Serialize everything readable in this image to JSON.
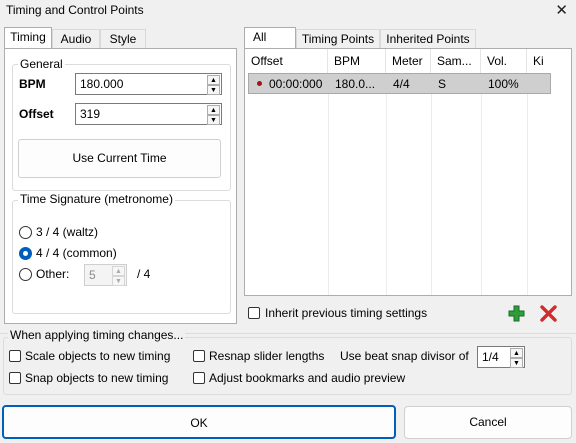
{
  "window": {
    "title": "Timing and Control Points"
  },
  "left_tabs": [
    "Timing",
    "Audio",
    "Style"
  ],
  "general": {
    "legend": "General",
    "bpm_label": "BPM",
    "bpm_value": "180.000",
    "offset_label": "Offset",
    "offset_value": "319",
    "use_current_time": "Use Current Time"
  },
  "time_signature": {
    "legend": "Time Signature (metronome)",
    "options": [
      "3 / 4 (waltz)",
      "4 / 4 (common)",
      "Other:"
    ],
    "selected_index": 1,
    "other_value": "5",
    "other_suffix": "/ 4"
  },
  "right_tabs": [
    "All",
    "Timing Points",
    "Inherited Points"
  ],
  "table": {
    "columns": [
      "Offset",
      "BPM",
      "Meter",
      "Sam...",
      "Vol.",
      "Ki"
    ],
    "rows": [
      {
        "offset": "00:00:000",
        "bpm": "180.0...",
        "meter": "4/4",
        "sample": "S",
        "volume": "100%",
        "kiai": ""
      }
    ]
  },
  "inherit_label": "Inherit previous timing settings",
  "applying": {
    "legend": "When applying timing changes...",
    "scale_objects": "Scale objects to new timing",
    "snap_objects": "Snap objects to new timing",
    "resnap_sliders": "Resnap slider lengths",
    "adjust_bookmarks": "Adjust bookmarks and audio preview",
    "beat_snap_label": "Use beat snap divisor of",
    "beat_snap_value": "1/4"
  },
  "buttons": {
    "ok": "OK",
    "cancel": "Cancel"
  },
  "colors": {
    "accent": "#005fb8",
    "add": "#2e9e3b",
    "delete": "#d22b2b",
    "row_dot": "#a31515"
  }
}
